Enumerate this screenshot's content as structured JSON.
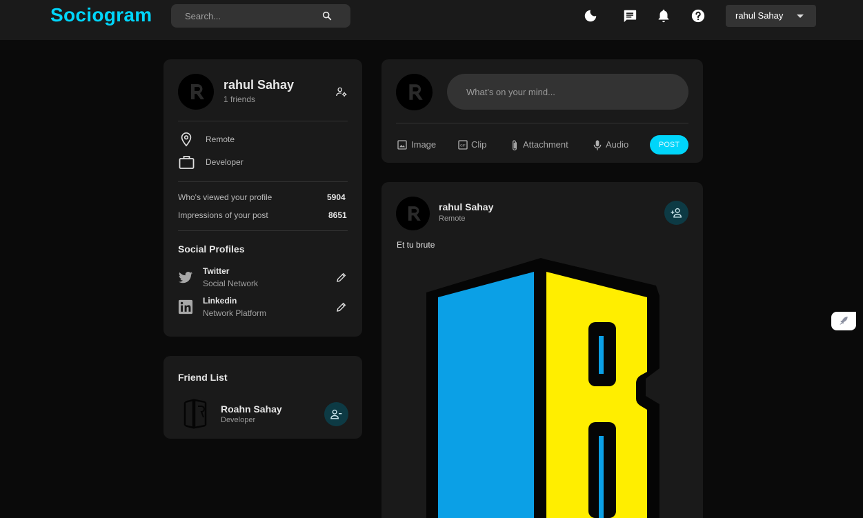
{
  "app": {
    "logo": "Sociogram",
    "brand_color": "#00d5fa"
  },
  "header": {
    "search": {
      "placeholder": "Search..."
    },
    "icons": [
      "dark-mode-icon",
      "message-icon",
      "notification-icon",
      "help-icon"
    ],
    "user_select": {
      "selected": "rahul Sahay"
    }
  },
  "profile": {
    "name": "rahul Sahay",
    "friends": "1 friends",
    "location": "Remote",
    "occupation": "Developer",
    "stats": [
      {
        "label": "Who's viewed your profile",
        "value": "5904"
      },
      {
        "label": "Impressions of your post",
        "value": "8651"
      }
    ],
    "social_title": "Social Profiles",
    "socials": [
      {
        "name": "Twitter",
        "desc": "Social Network",
        "icon": "twitter-icon"
      },
      {
        "name": "Linkedin",
        "desc": "Network Platform",
        "icon": "linkedin-icon"
      }
    ]
  },
  "friend_list": {
    "title": "Friend List",
    "friends": [
      {
        "name": "Roahn Sahay",
        "occupation": "Developer"
      }
    ]
  },
  "composer": {
    "placeholder": "What's on your mind...",
    "actions": [
      {
        "label": "Image",
        "icon": "image-icon"
      },
      {
        "label": "Clip",
        "icon": "gif-icon"
      },
      {
        "label": "Attachment",
        "icon": "attachment-icon"
      },
      {
        "label": "Audio",
        "icon": "mic-icon"
      }
    ],
    "post_button": "POST"
  },
  "feed": {
    "posts": [
      {
        "name": "rahul Sahay",
        "location": "Remote",
        "description": "Et tu brute"
      }
    ]
  }
}
